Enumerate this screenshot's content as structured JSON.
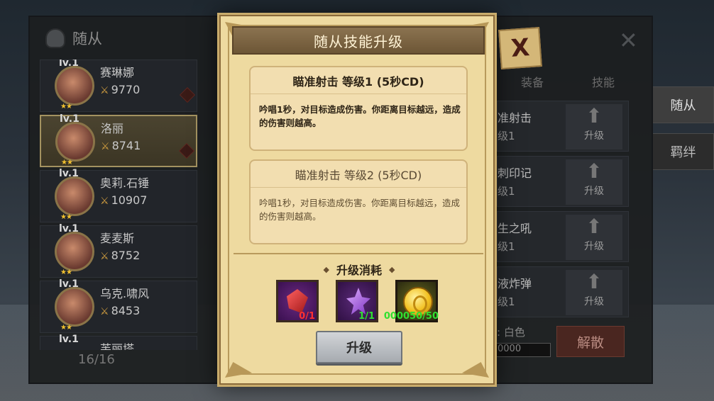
{
  "background": {
    "panel_title": "随从",
    "heroes": [
      {
        "level": "lv.1",
        "name": "赛琳娜",
        "power": "9770"
      },
      {
        "level": "lv.1",
        "name": "洛丽",
        "power": "8741"
      },
      {
        "level": "lv.1",
        "name": "奥莉.石锤",
        "power": "10907"
      },
      {
        "level": "lv.1",
        "name": "麦麦斯",
        "power": "8752"
      },
      {
        "level": "lv.1",
        "name": "乌克.啸风",
        "power": "8453"
      },
      {
        "level": "lv.1",
        "name": "芙丽塔",
        "power": ""
      }
    ],
    "hero_count": "16/16",
    "tabs": {
      "equip": "装备",
      "skill": "技能"
    },
    "skills": [
      {
        "name": "准射击",
        "level": "级1",
        "upgrade": "升级"
      },
      {
        "name": "刺印记",
        "level": "级1",
        "upgrade": "升级"
      },
      {
        "name": "生之吼",
        "level": "级1",
        "upgrade": "升级"
      },
      {
        "name": "液炸弹",
        "level": "级1",
        "upgrade": "升级"
      }
    ],
    "side_tabs": {
      "follower": "随从",
      "bond": "羁绊"
    },
    "quality": ": 白色",
    "gold_value": "0000",
    "dismiss": "解散"
  },
  "modal": {
    "title": "随从技能升级",
    "current": {
      "header": "瞄准射击  等级1 (5秒CD)",
      "description": "吟唱1秒，对目标造成伤害。你距离目标越远，造成的伤害则越高。"
    },
    "next": {
      "header": "瞄准射击  等级2 (5秒CD)",
      "description": "吟唱1秒，对目标造成伤害。你距离目标越远，造成的伤害则越高。"
    },
    "cost_title": "升级消耗",
    "costs": [
      {
        "icon": "red-gem-icon",
        "count": "0/1",
        "color": "#ff3030"
      },
      {
        "icon": "purple-crystal-icon",
        "count": "1/1",
        "color": "#30e030"
      },
      {
        "icon": "gold-coin-icon",
        "count": "000050/50",
        "color": "#30e030"
      }
    ],
    "upgrade_button": "升级",
    "close_label": "X"
  }
}
